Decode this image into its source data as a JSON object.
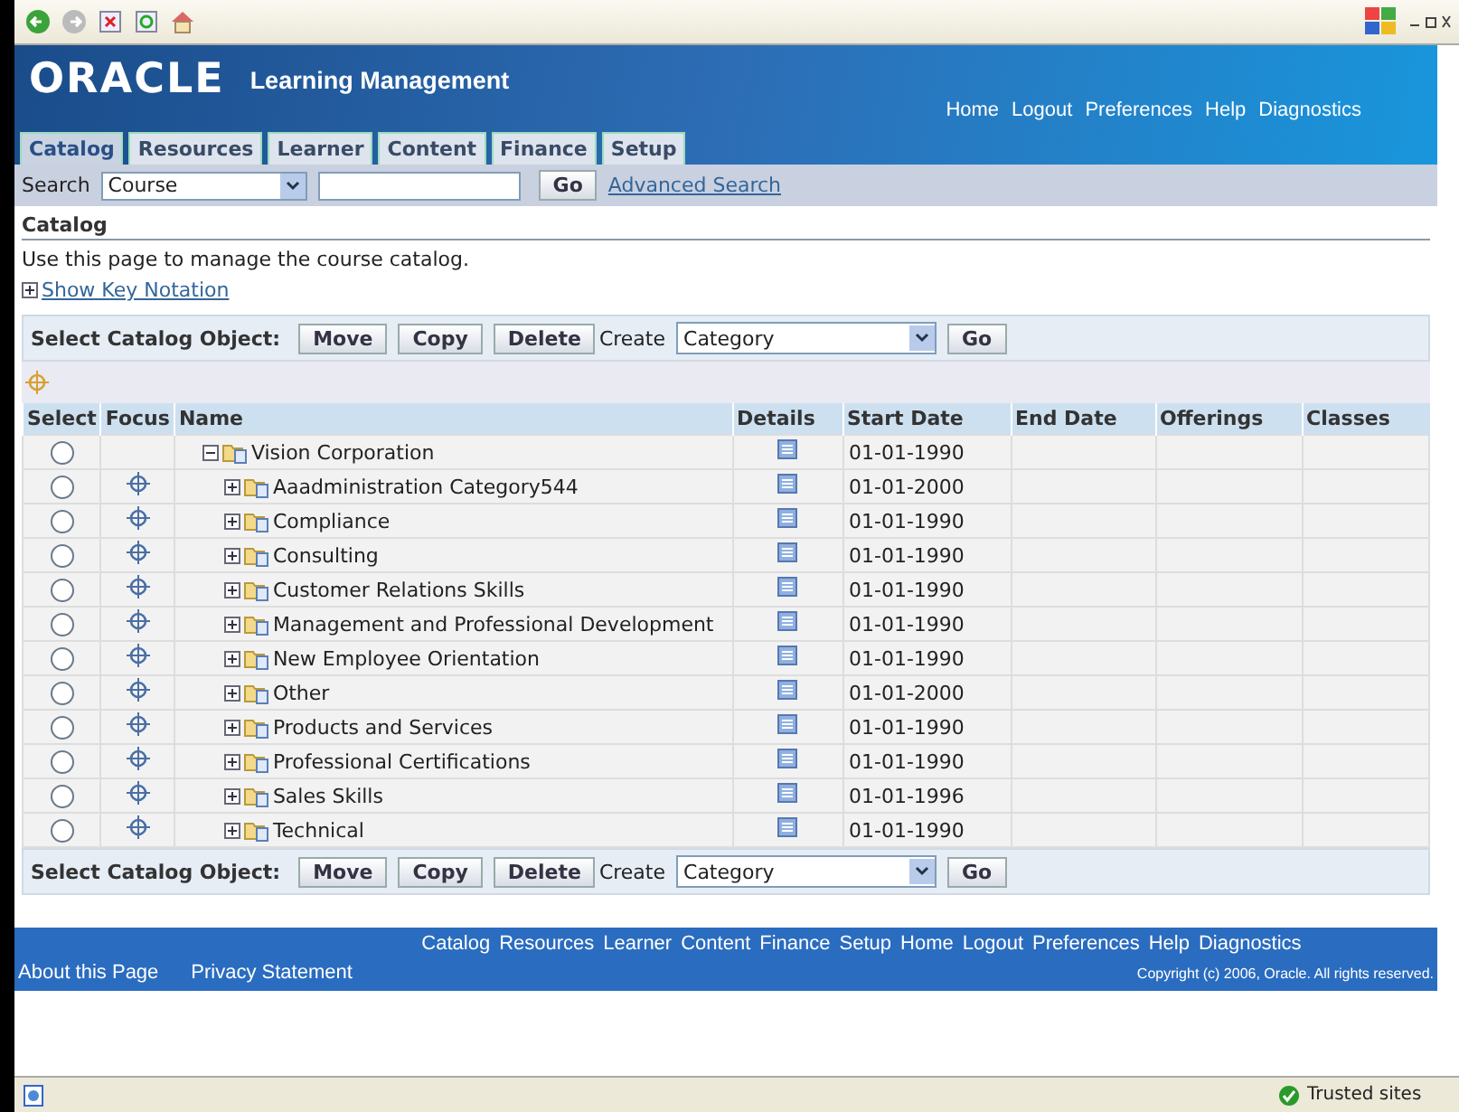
{
  "header": {
    "logo": "ORACLE",
    "app_title": "Learning Management",
    "global_links": [
      "Home",
      "Logout",
      "Preferences",
      "Help",
      "Diagnostics"
    ]
  },
  "tabs": [
    {
      "label": "Catalog",
      "selected": true
    },
    {
      "label": "Resources",
      "selected": false
    },
    {
      "label": "Learner",
      "selected": false
    },
    {
      "label": "Content",
      "selected": false
    },
    {
      "label": "Finance",
      "selected": false
    },
    {
      "label": "Setup",
      "selected": false
    }
  ],
  "search": {
    "label": "Search",
    "scope": "Course",
    "button": "Go",
    "advanced_link": "Advanced Search"
  },
  "page": {
    "title": "Catalog",
    "description": "Use this page to manage the course catalog.",
    "key_notation": "Show Key Notation"
  },
  "action_bars": [
    {
      "label": "Select Catalog Object:",
      "buttons": [
        "Move",
        "Copy",
        "Delete"
      ],
      "create_label": "Create",
      "create_value": "Category",
      "go": "Go"
    },
    {
      "label": "Select Catalog Object:",
      "buttons": [
        "Move",
        "Copy",
        "Delete"
      ],
      "create_label": "Create",
      "create_value": "Category",
      "go": "Go"
    }
  ],
  "table": {
    "columns": [
      "Select",
      "Focus",
      "Name",
      "Details",
      "Start Date",
      "End Date",
      "Offerings",
      "Classes"
    ],
    "rows": [
      {
        "name": "Vision Corporation",
        "expanded": true,
        "focus": false,
        "start_date": "01-01-1990",
        "selected": false,
        "children": [
          {
            "name": "Aaadministration Category544",
            "expanded": false,
            "focus": true,
            "start_date": "01-01-2000",
            "selected": false
          },
          {
            "name": "Compliance",
            "expanded": false,
            "focus": true,
            "start_date": "01-01-1990",
            "selected": false
          },
          {
            "name": "Consulting",
            "expanded": false,
            "focus": true,
            "start_date": "01-01-1990",
            "selected": false
          },
          {
            "name": "Customer Relations Skills",
            "expanded": false,
            "focus": true,
            "start_date": "01-01-1990",
            "selected": false
          },
          {
            "name": "Management and Professional Development",
            "expanded": false,
            "focus": true,
            "start_date": "01-01-1990",
            "selected": false
          },
          {
            "name": "New Employee Orientation",
            "expanded": false,
            "focus": true,
            "start_date": "01-01-1990",
            "selected": false
          },
          {
            "name": "Other",
            "expanded": false,
            "focus": true,
            "start_date": "01-01-2000",
            "selected": false
          },
          {
            "name": "Products and Services",
            "expanded": false,
            "focus": true,
            "start_date": "01-01-1990",
            "selected": false
          },
          {
            "name": "Professional Certifications",
            "expanded": false,
            "focus": true,
            "start_date": "01-01-1990",
            "selected": false
          },
          {
            "name": "Sales Skills",
            "expanded": false,
            "focus": true,
            "start_date": "01-01-1996",
            "selected": false
          },
          {
            "name": "Technical",
            "expanded": false,
            "focus": true,
            "start_date": "01-01-1990",
            "selected": false
          }
        ]
      }
    ]
  },
  "footer": {
    "links": [
      "Catalog",
      "Resources",
      "Learner",
      "Content",
      "Finance",
      "Setup",
      "Home",
      "Logout",
      "Preferences",
      "Help",
      "Diagnostics"
    ],
    "bottom_links": [
      "About this Page",
      "Privacy Statement"
    ],
    "copyright": "Copyright (c) 2006, Oracle. All rights reserved."
  },
  "status_bar": {
    "zone": "Trusted sites"
  }
}
